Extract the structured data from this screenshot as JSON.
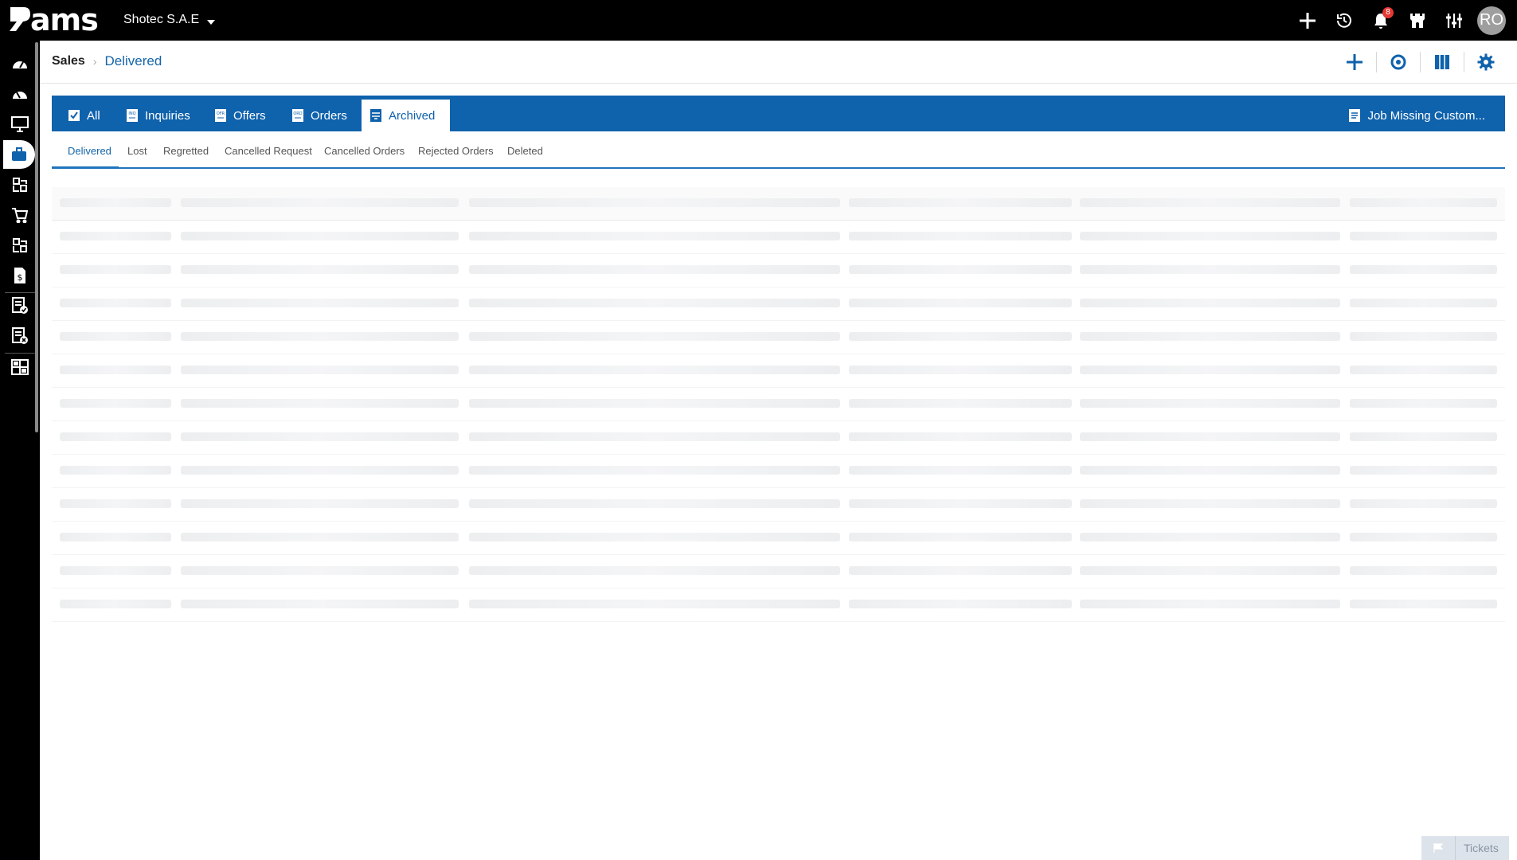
{
  "app": {
    "logo_text": "ams",
    "company": "Shotec S.A.E",
    "notifications_count": "8",
    "user_initials": "RO"
  },
  "top_icons": [
    "plus-icon",
    "history-clock-icon",
    "bell-icon",
    "castle-icon",
    "sliders-icon"
  ],
  "sidebar": {
    "items": [
      {
        "name": "dashboard-icon"
      },
      {
        "name": "dashboard-alt-icon"
      },
      {
        "name": "monitor-icon"
      },
      {
        "name": "briefcase-icon",
        "active": true
      },
      {
        "name": "modules-icon"
      },
      {
        "name": "cart-icon"
      },
      {
        "name": "modules-alt-icon"
      },
      {
        "name": "invoice-dollar-icon"
      },
      {
        "name": "document-check-icon"
      },
      {
        "name": "document-cancel-icon"
      },
      {
        "name": "grid-layout-icon"
      }
    ]
  },
  "breadcrumb": {
    "root": "Sales",
    "current": "Delivered"
  },
  "header_actions": [
    "add-icon",
    "refresh-icon",
    "columns-icon",
    "settings-gear-icon"
  ],
  "tabs": [
    {
      "label": "All",
      "icon": "checkbox-icon"
    },
    {
      "label": "Inquiries",
      "icon": "inquiry-doc-icon"
    },
    {
      "label": "Offers",
      "icon": "offer-doc-icon"
    },
    {
      "label": "Orders",
      "icon": "order-doc-icon"
    },
    {
      "label": "Archived",
      "icon": "archive-icon",
      "active": true
    }
  ],
  "right_tab": {
    "label": "Job Missing Custom...",
    "icon": "document-icon"
  },
  "subtabs": [
    {
      "label": "Delivered",
      "active": true
    },
    {
      "label": "Lost"
    },
    {
      "label": "Regretted"
    },
    {
      "label": "Cancelled Request"
    },
    {
      "label": "Cancelled Orders"
    },
    {
      "label": "Rejected Orders"
    },
    {
      "label": "Deleted"
    }
  ],
  "table": {
    "state": "loading",
    "placeholder_rows": 13,
    "placeholder_columns": 6
  },
  "tickets": {
    "label": "Tickets"
  },
  "colors": {
    "primary": "#0f62ac",
    "topbar": "#000000",
    "badge": "#e53935",
    "link": "#1565a8"
  }
}
